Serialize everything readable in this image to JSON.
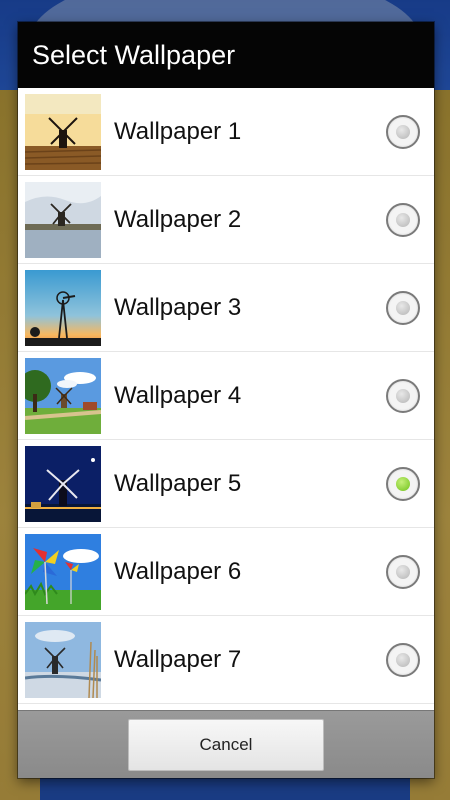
{
  "dialog": {
    "title": "Select Wallpaper",
    "cancel_label": "Cancel"
  },
  "wallpapers": [
    {
      "label": "Wallpaper 1",
      "selected": false,
      "thumb": "windmill-field-icon"
    },
    {
      "label": "Wallpaper 2",
      "selected": false,
      "thumb": "windmill-water-icon"
    },
    {
      "label": "Wallpaper 3",
      "selected": false,
      "thumb": "windpump-sunset-icon"
    },
    {
      "label": "Wallpaper 4",
      "selected": false,
      "thumb": "windmill-tree-icon"
    },
    {
      "label": "Wallpaper 5",
      "selected": true,
      "thumb": "windmill-night-icon"
    },
    {
      "label": "Wallpaper 6",
      "selected": false,
      "thumb": "pinwheel-icon"
    },
    {
      "label": "Wallpaper 7",
      "selected": false,
      "thumb": "windmill-winter-icon"
    }
  ],
  "colors": {
    "selected_radio": "#7dcc22",
    "title_bar": "#050505"
  }
}
